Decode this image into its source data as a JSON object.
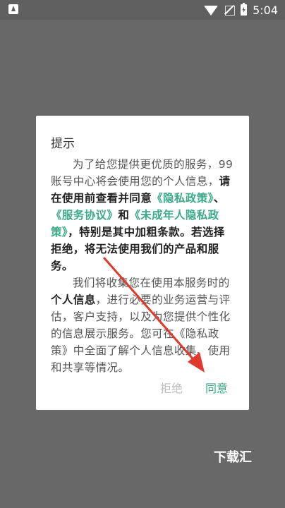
{
  "status_bar": {
    "time": "5:04",
    "icons": [
      "app-notification-icon",
      "wifi-icon",
      "no-signal-icon",
      "battery-charging-icon"
    ]
  },
  "dialog": {
    "title": "提示",
    "p1": {
      "t1": "为了给您提供更优质的服务，99账号中心将会使用您的个人信息，",
      "b1": "请在使用前查看并同意",
      "link1": "《隐私政策》",
      "sep1": "、",
      "link2": "《服务协议》",
      "and": "和",
      "link3": "《未成年人隐私政策》",
      "b2": "，特别是其中加粗条款。若选择拒绝，将无法使用我们的产品和服务。"
    },
    "p2": {
      "t1": "我们将收集您在使用本服务时的",
      "b1": "个人信息",
      "t2": "，进行必要的业务运营与评估，客户支持，以及为您提供个性化的信息展示服务。您可在《隐私政策》中全面了解个人信息收集、使用和共享等情况。"
    },
    "buttons": {
      "decline": "拒绝",
      "agree": "同意"
    }
  },
  "colors": {
    "accent": "#3aa989",
    "overlay": "#686868",
    "annotation_arrow": "#e03a2f"
  },
  "watermark": "下载汇"
}
